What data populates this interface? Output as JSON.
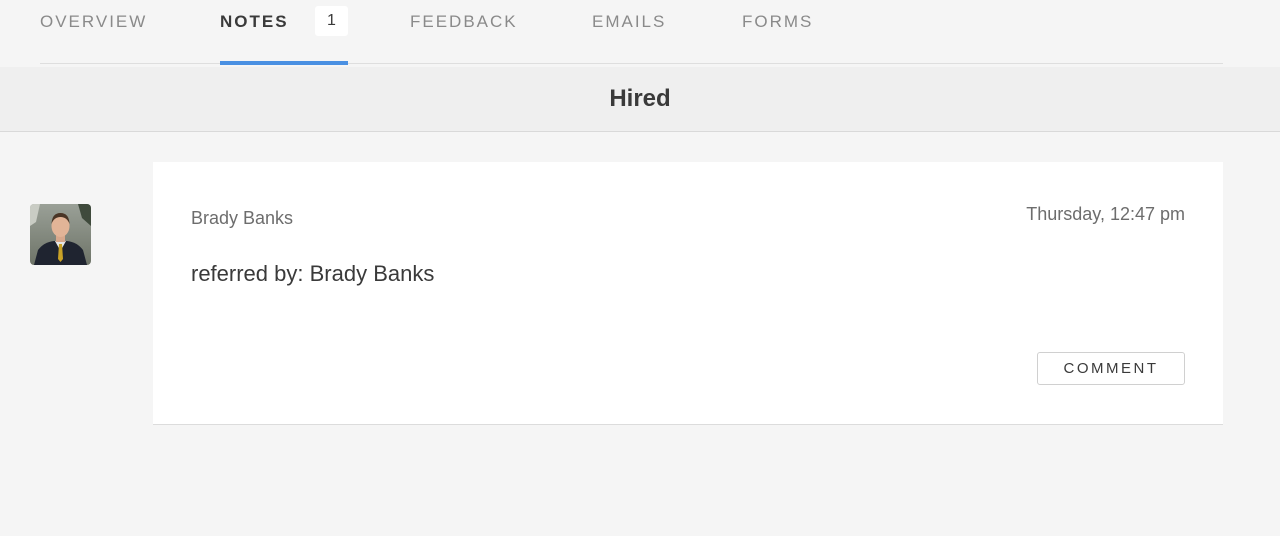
{
  "tabs": [
    {
      "label": "OVERVIEW",
      "active": false
    },
    {
      "label": "NOTES",
      "active": true,
      "badge": "1"
    },
    {
      "label": "FEEDBACK",
      "active": false
    },
    {
      "label": "EMAILS",
      "active": false
    },
    {
      "label": "FORMS",
      "active": false
    }
  ],
  "stage": {
    "title": "Hired"
  },
  "note": {
    "author": "Brady Banks",
    "timestamp": "Thursday, 12:47 pm",
    "body": "referred by: Brady Banks",
    "comment_label": "COMMENT"
  },
  "colors": {
    "accent": "#4a90e2",
    "background": "#f5f5f5",
    "card": "#ffffff"
  },
  "icons": {
    "avatar": "user-avatar-photo"
  }
}
